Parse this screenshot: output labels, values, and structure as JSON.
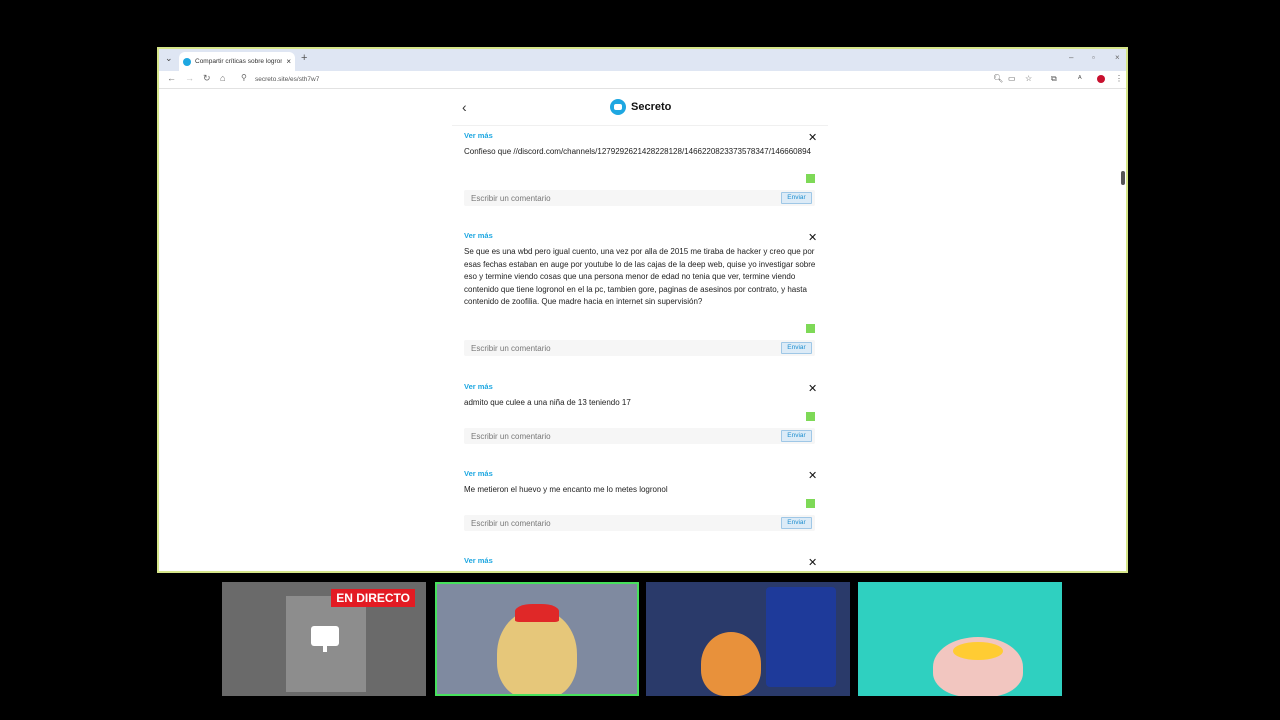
{
  "browser": {
    "tab_title": "Compartir críticas sobre logrono",
    "url": "secreto.site/es/sth7w7"
  },
  "app": {
    "brand": "Secreto"
  },
  "posts": [
    {
      "ver_mas": "Ver más",
      "text": "Confieso que //discord.com/channels/1279292621428228128/1466220823373578347/146660894",
      "placeholder": "Escribir un comentario",
      "send": "Enviar"
    },
    {
      "ver_mas": "Ver más",
      "text": "Se que es una wbd pero igual cuento, una vez por alla de 2015 me tiraba de hacker y creo que por esas fechas estaban en auge por youtube lo de las cajas de la deep web, quise yo investigar sobre eso y termine viendo cosas que una persona menor de edad no tenia que ver, termine viendo contenido que tiene logronol en el la pc, tambien gore, paginas de asesinos por contrato, y hasta contenido de zoofilia. Que madre hacia en internet sin supervisión?",
      "placeholder": "Escribir un comentario",
      "send": "Enviar"
    },
    {
      "ver_mas": "Ver más",
      "text": "admito que culee a una niña de 13 teniendo 17",
      "placeholder": "Escribir un comentario",
      "send": "Enviar"
    },
    {
      "ver_mas": "Ver más",
      "text": "Me metieron el huevo y me encanto me lo metes logronol",
      "placeholder": "Escribir un comentario",
      "send": "Enviar"
    },
    {
      "ver_mas": "Ver más"
    }
  ],
  "stream": {
    "live_badge": "EN DIRECTO"
  },
  "colors": {
    "accent": "#1ea7e1",
    "active_cam_border": "#47e05d",
    "live_red": "#e31b23"
  }
}
